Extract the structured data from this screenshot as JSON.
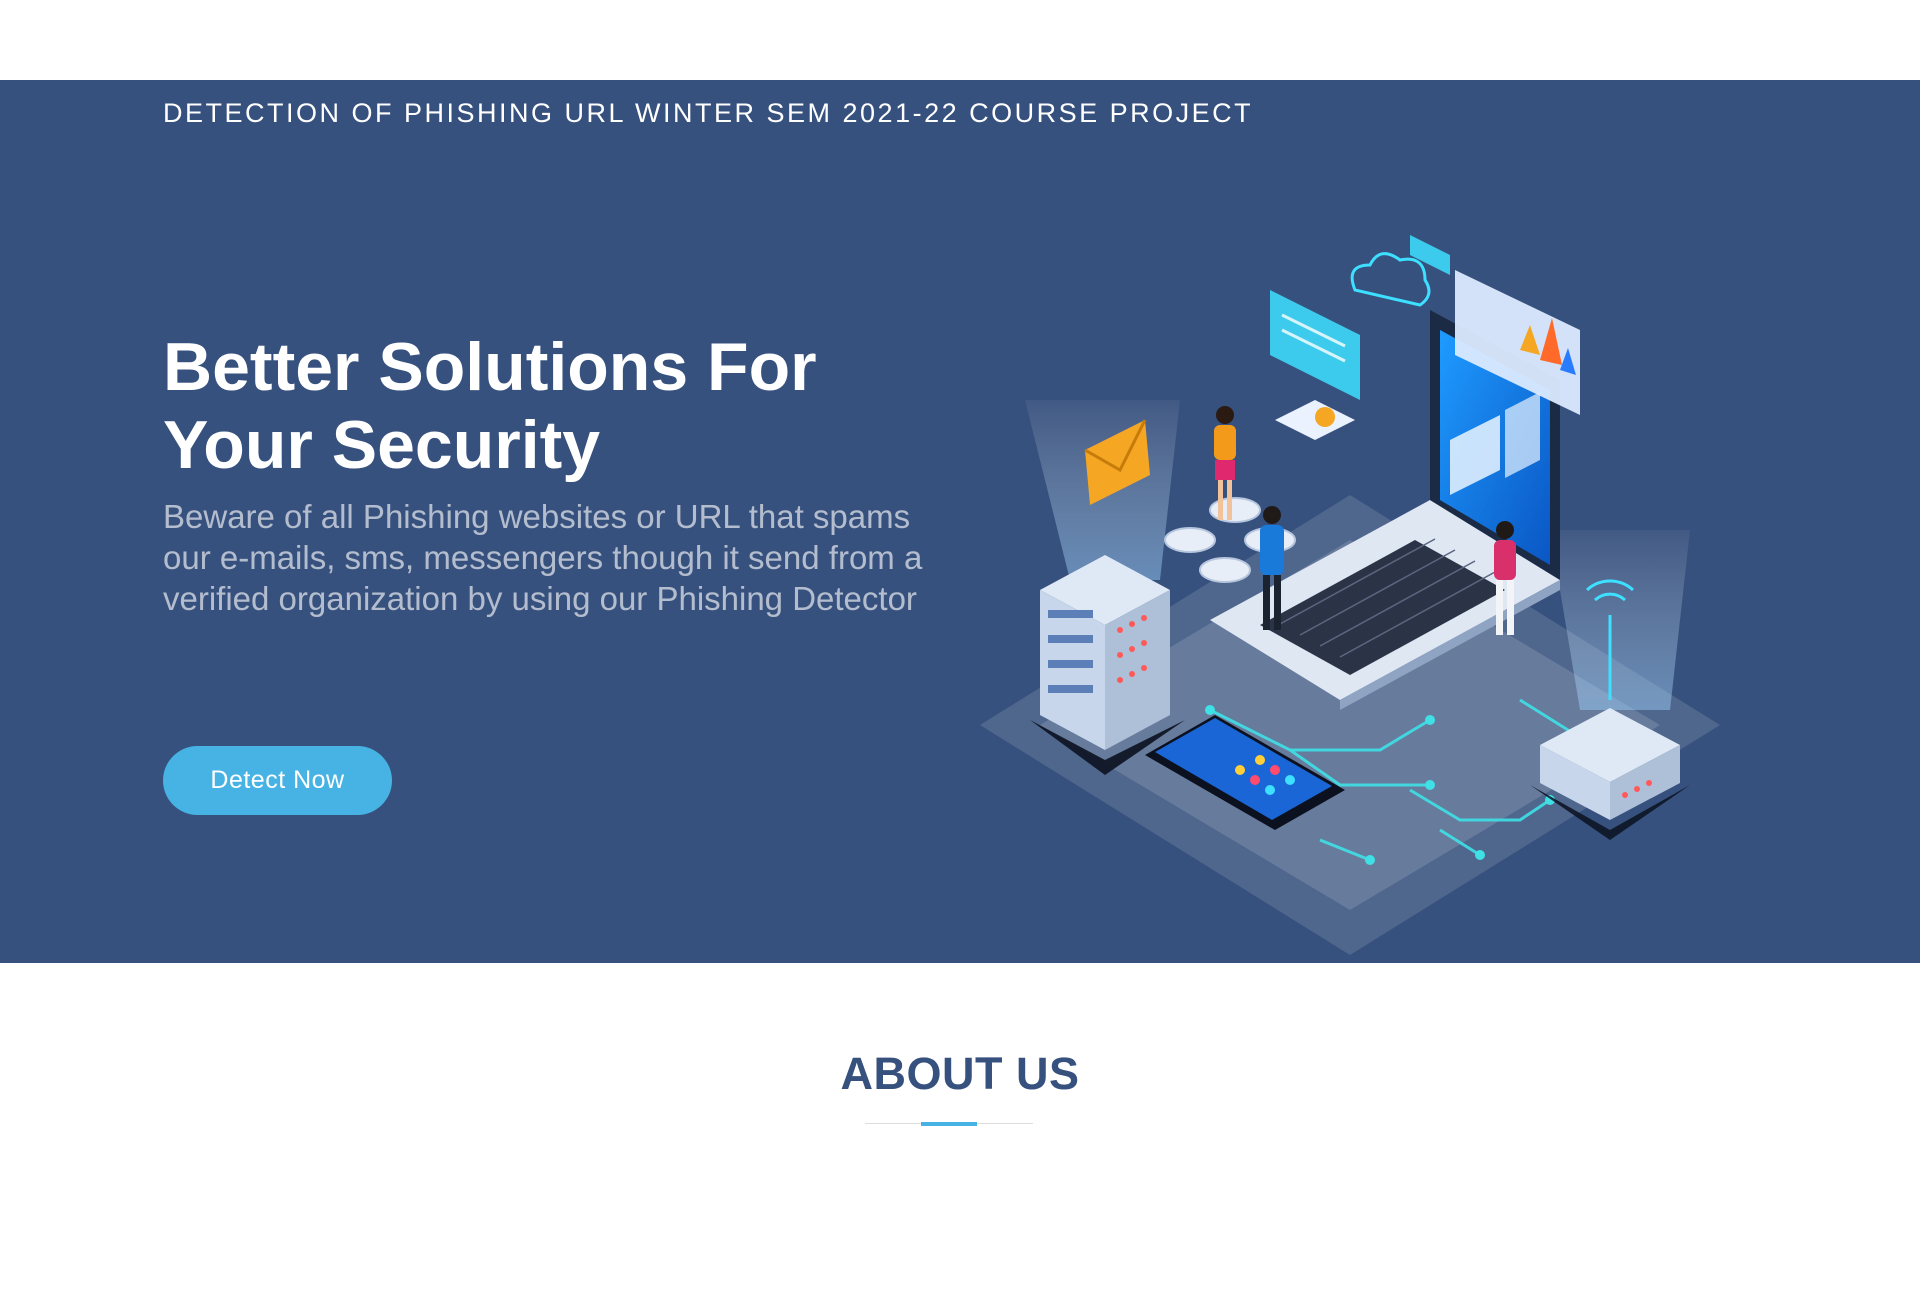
{
  "header": {
    "brand_title": "DETECTION OF PHISHING URL WINTER SEM 2021-22 COURSE PROJECT"
  },
  "hero": {
    "title_line1": "Better Solutions For",
    "title_line2": "Your Security",
    "subtitle": "Beware of all Phishing websites or URL that spams our e-mails, sms, messengers though it send from a verified organization by using our Phishing Detector",
    "cta_label": "Detect Now",
    "illustration_icon": "isometric-security-illustration"
  },
  "about": {
    "title": "ABOUT US"
  },
  "colors": {
    "hero_bg": "#37517e",
    "accent": "#47b2e4",
    "heading_dark": "#37517e"
  }
}
